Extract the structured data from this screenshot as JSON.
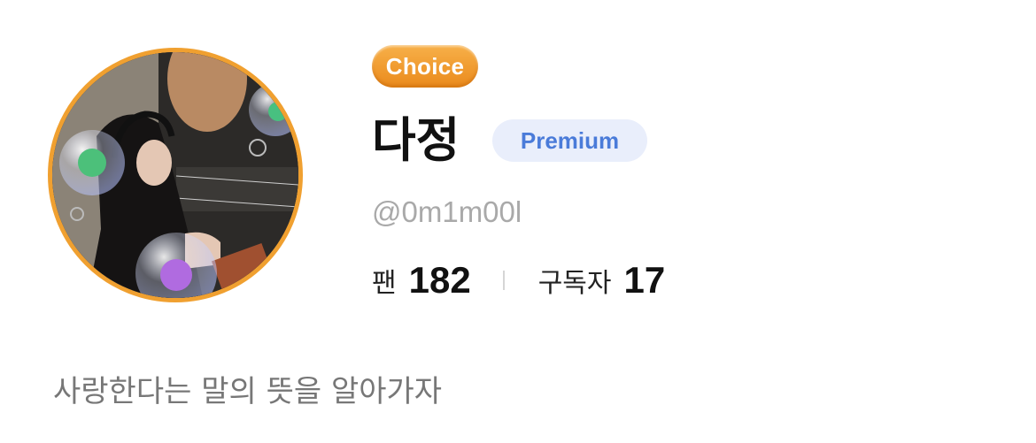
{
  "profile": {
    "choice_badge": "Choice",
    "display_name": "다정",
    "premium_badge": "Premium",
    "handle": "@0m1m00l",
    "bio": "사랑한다는 말의 뜻을 알아가자"
  },
  "stats": {
    "fans_label": "팬",
    "fans_count": "182",
    "subscribers_label": "구독자",
    "subscribers_count": "17"
  },
  "colors": {
    "avatar_ring": "#f0a030",
    "choice_badge": "#ef9a2a",
    "premium_text": "#4a7bd9",
    "premium_bg": "#e9eefb"
  }
}
